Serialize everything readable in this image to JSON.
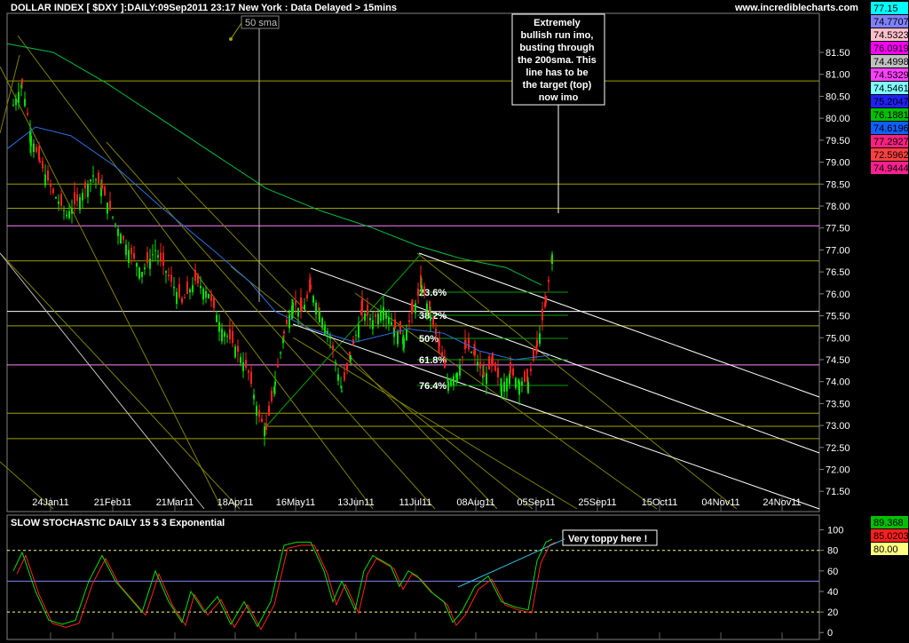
{
  "header": {
    "title": "DOLLAR INDEX [ $DXY ]:DAILY:09Sep2011 23:17 New York  : Data Delayed > 15mins",
    "website": "www.incrediblecharts.com"
  },
  "chart_data": [
    {
      "type": "candlestick",
      "title": "DOLLAR INDEX [ $DXY ]:DAILY:09Sep2011 23:17 New York  : Data Delayed > 15mins",
      "x_ticks": [
        "24Jan11",
        "21Feb11",
        "21Mar11",
        "18Apr11",
        "16May11",
        "13Jun11",
        "11Jul11",
        "08Aug11",
        "05Sep11",
        "25Sep11",
        "15Oct11",
        "04Nov11",
        "24Nov11"
      ],
      "y_ticks": [
        "71.50",
        "72.00",
        "72.50",
        "73.00",
        "73.50",
        "74.00",
        "74.50",
        "75.00",
        "75.50",
        "76.00",
        "76.50",
        "77.00",
        "77.50",
        "78.00",
        "78.50",
        "79.00",
        "79.50",
        "80.00",
        "80.50",
        "81.00",
        "81.50"
      ],
      "ylim": [
        71.1,
        82.35
      ],
      "horizontal_levels": [
        80.85,
        78.5,
        77.95,
        77.55,
        76.75,
        75.6,
        75.27,
        74.38,
        73.28,
        72.7
      ],
      "fib_labels": [
        "23.6%",
        "38.2%",
        "50%",
        "61.8%",
        "76.4%"
      ],
      "legend_values": [
        {
          "label": "77.15",
          "color": "#00ffff"
        },
        {
          "label": "74.7707",
          "color": "#8080ff"
        },
        {
          "label": "74.5323",
          "color": "#ffc0cb"
        },
        {
          "label": "76.0919",
          "color": "#ff00ff"
        },
        {
          "label": "74.4998",
          "color": "#c0c0c0"
        },
        {
          "label": "74.5329",
          "color": "#ff40ff"
        },
        {
          "label": "74.5461",
          "color": "#80ffff"
        },
        {
          "label": "75.2047",
          "color": "#2020ff"
        },
        {
          "label": "76.1881",
          "color": "#00c000"
        },
        {
          "label": "74.6196",
          "color": "#1060ff"
        },
        {
          "label": "77.2927",
          "color": "#ff2080"
        },
        {
          "label": "72.5962",
          "color": "#ff4040"
        },
        {
          "label": "74.9444",
          "color": "#ff2090"
        }
      ],
      "annotations": {
        "sma_label": "50 sma",
        "callout": [
          "Extremely",
          "bullish run imo,",
          "busting through",
          "the 200sma. This",
          "line has to be",
          "the target (top)",
          "now imo"
        ]
      }
    },
    {
      "type": "line",
      "title": "SLOW STOCHASTIC DAILY 15 5 3 Exponential",
      "y_ticks": [
        "0",
        "20",
        "40",
        "60",
        "80",
        "100"
      ],
      "ylim": [
        -5,
        110
      ],
      "reference_lines": [
        20,
        50,
        80
      ],
      "legend_values": [
        {
          "label": "89.368",
          "color": "#00c000"
        },
        {
          "label": "85.0203",
          "color": "#ff2020"
        },
        {
          "label": "80.00",
          "color": "#ffff80"
        }
      ],
      "annotation": "Very toppy here !"
    }
  ]
}
